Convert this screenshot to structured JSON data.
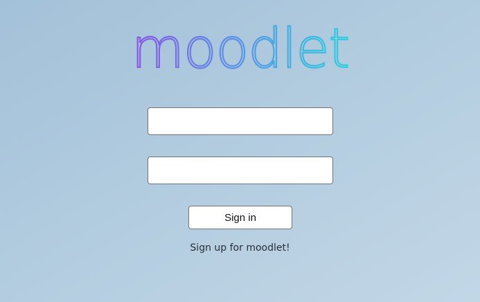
{
  "brand": {
    "logo_text": "moodlet",
    "gradient_start": "#8a54e6",
    "gradient_mid": "#5b8ee8",
    "gradient_end": "#2ad0e0"
  },
  "login_form": {
    "username_value": "",
    "password_value": "",
    "signin_label": "Sign in",
    "signup_link_text": "Sign up for moodlet!"
  },
  "colors": {
    "background_start": "#a3c1d9",
    "background_end": "#c2d7e6",
    "text": "#2a2f36"
  }
}
